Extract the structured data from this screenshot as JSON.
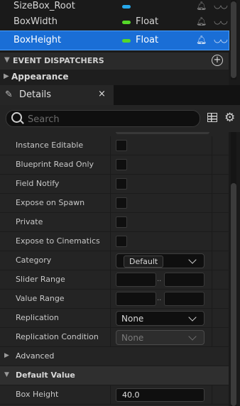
{
  "variables": [
    {
      "name": "SizeBox_Root",
      "type": "",
      "pill_color": "#27a8ea"
    },
    {
      "name": "BoxWidth",
      "type": "Float",
      "pill_color": "#55d829"
    },
    {
      "name": "BoxHeight",
      "type": "Float",
      "pill_color": "#55d829",
      "selected": true
    }
  ],
  "event_dispatchers": {
    "label": "EVENT DISPATCHERS"
  },
  "appearance": {
    "label": "Appearance"
  },
  "details_tab": {
    "label": "Details",
    "close": "×"
  },
  "search": {
    "placeholder": "Search"
  },
  "properties": {
    "instance_editable": "Instance Editable",
    "blueprint_read_only": "Blueprint Read Only",
    "field_notify": "Field Notify",
    "expose_on_spawn": "Expose on Spawn",
    "private": "Private",
    "expose_to_cinematics": "Expose to Cinematics",
    "category": {
      "label": "Category",
      "value": "Default"
    },
    "slider_range": {
      "label": "Slider Range",
      "separator": ".."
    },
    "value_range": {
      "label": "Value Range",
      "separator": ".."
    },
    "replication": {
      "label": "Replication",
      "value": "None"
    },
    "replication_condition": {
      "label": "Replication Condition",
      "value": "None"
    }
  },
  "advanced": {
    "label": "Advanced"
  },
  "default_value": {
    "label": "Default Value",
    "field_label": "Box Height",
    "value": "40.0"
  },
  "colors": {
    "selection": "#1a6ed6",
    "float_pin": "#55d829",
    "object_pin": "#27a8ea"
  }
}
